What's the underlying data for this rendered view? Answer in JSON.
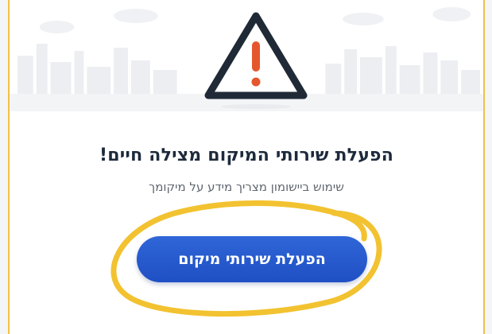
{
  "dialog": {
    "title": "הפעלת שירותי המיקום מצילה חיים!",
    "subtitle": "שימוש ביישומון מצריך מידע על מיקומך",
    "button_label": "הפעלת שירותי מיקום"
  },
  "icons": {
    "alert": "warning-triangle-icon"
  },
  "colors": {
    "accent": "#2a5fd3",
    "warning_mark": "#e4572e",
    "title_text": "#1d2a3c",
    "highlight": "#f2c230"
  }
}
